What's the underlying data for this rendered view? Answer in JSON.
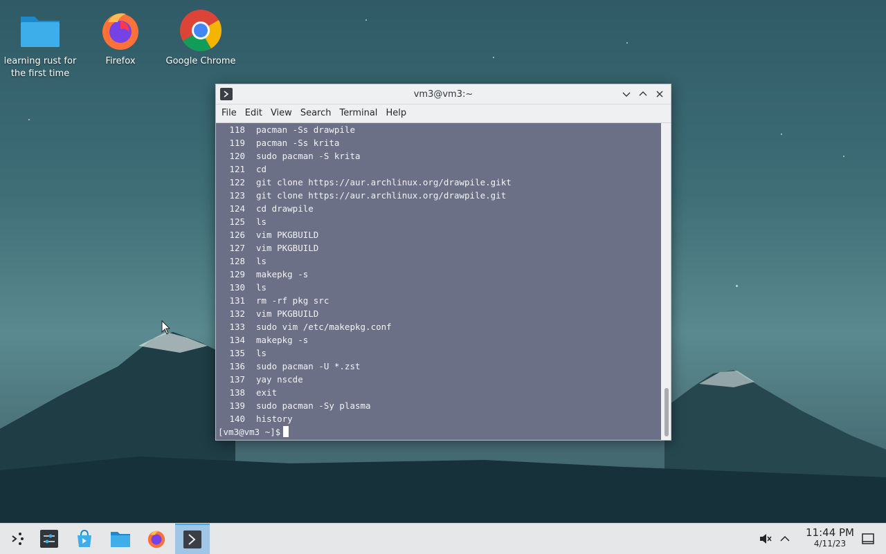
{
  "desktop": {
    "icons": [
      {
        "label": "learning rust for the first time",
        "icon": "folder-icon"
      },
      {
        "label": "Firefox",
        "icon": "firefox-icon"
      },
      {
        "label": "Google Chrome",
        "icon": "chrome-icon"
      }
    ]
  },
  "window": {
    "title": "vm3@vm3:~",
    "menu": [
      "File",
      "Edit",
      "View",
      "Search",
      "Terminal",
      "Help"
    ],
    "history": [
      {
        "n": "118",
        "cmd": "pacman -Ss drawpile"
      },
      {
        "n": "119",
        "cmd": "pacman -Ss krita"
      },
      {
        "n": "120",
        "cmd": "sudo pacman -S krita"
      },
      {
        "n": "121",
        "cmd": "cd"
      },
      {
        "n": "122",
        "cmd": "git clone https://aur.archlinux.org/drawpile.gikt"
      },
      {
        "n": "123",
        "cmd": "git clone https://aur.archlinux.org/drawpile.git"
      },
      {
        "n": "124",
        "cmd": "cd drawpile"
      },
      {
        "n": "125",
        "cmd": "ls"
      },
      {
        "n": "126",
        "cmd": "vim PKGBUILD"
      },
      {
        "n": "127",
        "cmd": "vim PKGBUILD"
      },
      {
        "n": "128",
        "cmd": "ls"
      },
      {
        "n": "129",
        "cmd": "makepkg -s"
      },
      {
        "n": "130",
        "cmd": "ls"
      },
      {
        "n": "131",
        "cmd": "rm -rf pkg src"
      },
      {
        "n": "132",
        "cmd": "vim PKGBUILD"
      },
      {
        "n": "133",
        "cmd": "sudo vim /etc/makepkg.conf"
      },
      {
        "n": "134",
        "cmd": "makepkg -s"
      },
      {
        "n": "135",
        "cmd": "ls"
      },
      {
        "n": "136",
        "cmd": "sudo pacman -U *.zst"
      },
      {
        "n": "137",
        "cmd": "yay nscde"
      },
      {
        "n": "138",
        "cmd": "exit"
      },
      {
        "n": "139",
        "cmd": "sudo pacman -Sy plasma"
      },
      {
        "n": "140",
        "cmd": "history"
      }
    ],
    "prompt": "[vm3@vm3 ~]$"
  },
  "taskbar": {
    "items": [
      {
        "name": "app-launcher-icon"
      },
      {
        "name": "system-settings-icon"
      },
      {
        "name": "discover-icon"
      },
      {
        "name": "file-manager-icon"
      },
      {
        "name": "firefox-icon"
      },
      {
        "name": "terminal-icon"
      }
    ],
    "time": "11:44 PM",
    "date": "4/11/23"
  },
  "colors": {
    "terminal_bg": "#6b7087",
    "active_task": "#9fc6e6",
    "accent": "#3daee9"
  }
}
